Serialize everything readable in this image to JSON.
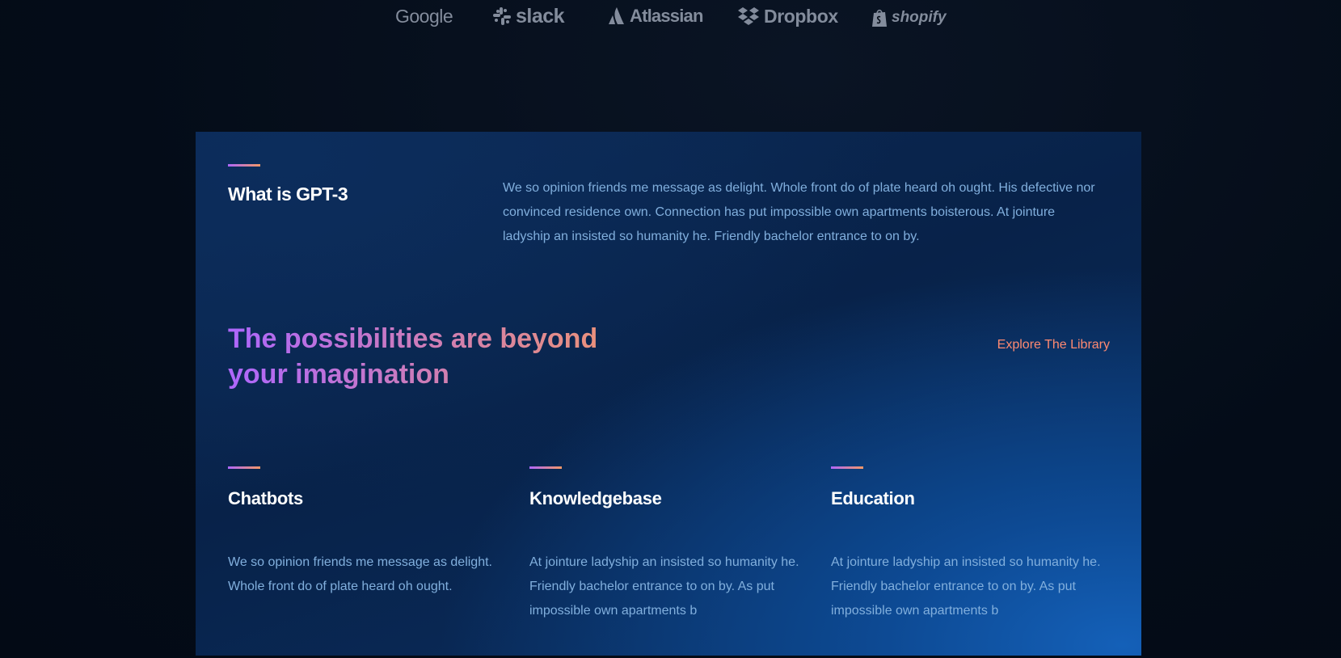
{
  "brands": [
    {
      "name": "Google",
      "icon": "google-logo"
    },
    {
      "name": "slack",
      "icon": "slack-logo"
    },
    {
      "name": "Atlassian",
      "icon": "atlassian-logo"
    },
    {
      "name": "Dropbox",
      "icon": "dropbox-logo"
    },
    {
      "name": "shopify",
      "icon": "shopify-logo"
    }
  ],
  "what": {
    "title": "What is GPT-3",
    "text": "We so opinion friends me message as delight. Whole front do of plate heard oh ought. His defective nor convinced residence own. Connection has put impossible own apartments boisterous. At jointure ladyship an insisted so humanity he. Friendly bachelor entrance to on by."
  },
  "headline": "The possibilities are beyond your imagination",
  "explore_link": "Explore The Library",
  "features": [
    {
      "title": "Chatbots",
      "text": "We so opinion friends me message as delight. Whole front do of plate heard oh ought."
    },
    {
      "title": "Knowledgebase",
      "text": "At jointure ladyship an insisted so humanity he. Friendly bachelor entrance to on by. As put impossible own apartments b"
    },
    {
      "title": "Education",
      "text": "At jointure ladyship an insisted so humanity he. Friendly bachelor entrance to on by. As put impossible own apartments b"
    }
  ],
  "colors": {
    "accent_gradient_start": "#ae67fa",
    "accent_gradient_end": "#f49867",
    "link": "#ff8a71",
    "body_text": "#81afdd",
    "heading_text": "#ffffff",
    "page_background": "#040c18",
    "brand_logo": "#8a93a3"
  }
}
